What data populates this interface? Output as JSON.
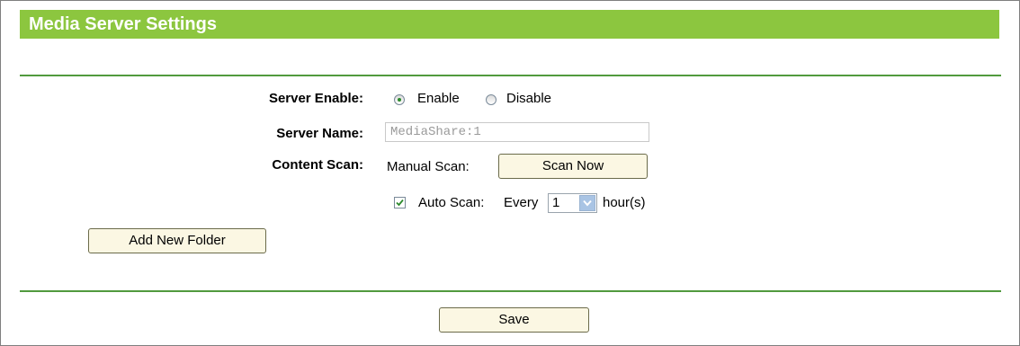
{
  "header": {
    "title": "Media Server Settings"
  },
  "form": {
    "server_enable": {
      "label": "Server Enable:",
      "options": [
        {
          "label": "Enable",
          "selected": true
        },
        {
          "label": "Disable",
          "selected": false
        }
      ]
    },
    "server_name": {
      "label": "Server Name:",
      "value": "MediaShare:1"
    },
    "content_scan": {
      "label": "Content Scan:",
      "manual_label": "Manual Scan:",
      "scan_button": "Scan Now",
      "auto_scan_checked": true,
      "auto_scan_label": "Auto Scan:",
      "every_label": "Every",
      "interval_value": "1",
      "unit_label": "hour(s)"
    },
    "add_folder_button": "Add New Folder"
  },
  "footer": {
    "save_button": "Save"
  },
  "colors": {
    "title_bar": "#8cc63f",
    "divider": "#519a3e",
    "button_bg": "#fbf7e3"
  }
}
